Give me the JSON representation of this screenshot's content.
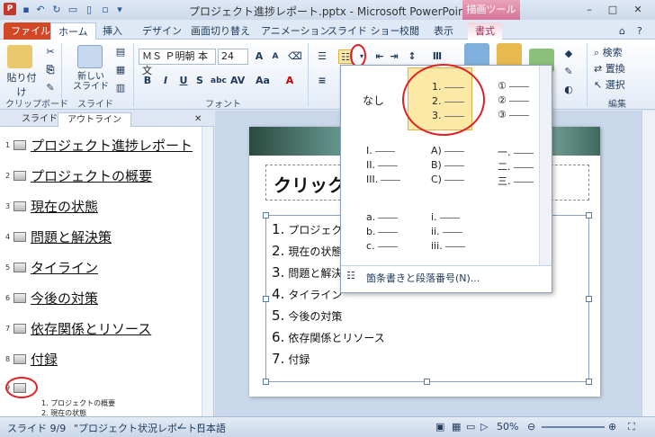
{
  "titlebar": {
    "title": "プロジェクト進捗レポート.pptx - Microsoft PowerPoint",
    "context_tools": "描画ツール",
    "app_icon": "P"
  },
  "tabs": [
    "ファイル",
    "ホーム",
    "挿入",
    "デザイン",
    "画面切り替え",
    "アニメーション",
    "スライド ショー",
    "校閲",
    "表示",
    "書式"
  ],
  "ribbon": {
    "paste_label": "貼り付け",
    "new_slide_label": "新しい\nスライド",
    "clipboard_group": "クリップボード",
    "slides_group": "スライド",
    "font_group": "フォント",
    "edit_group": "編集",
    "font_name": "ＭＳ Ｐ明朝 本文",
    "font_size": "24",
    "search_label": "検索",
    "replace_label": "置換",
    "select_label": "選択"
  },
  "left_panel": {
    "tabs": [
      "スライド",
      "アウトライン"
    ],
    "items": [
      {
        "num": "1",
        "text": "プロジェクト進捗レポート"
      },
      {
        "num": "2",
        "text": "プロジェクトの概要"
      },
      {
        "num": "3",
        "text": "現在の状態"
      },
      {
        "num": "4",
        "text": "問題と解決策"
      },
      {
        "num": "5",
        "text": "タイライン"
      },
      {
        "num": "6",
        "text": "今後の対策"
      },
      {
        "num": "7",
        "text": "依存関係とリソース"
      },
      {
        "num": "8",
        "text": "付録"
      },
      {
        "num": "9",
        "text": ""
      }
    ],
    "sub_items": [
      "1. プロジェクトの概要",
      "2. 現在の状態"
    ]
  },
  "slide": {
    "title": "クリック",
    "bullets": [
      {
        "num": "1.",
        "text": "プロジェク"
      },
      {
        "num": "2.",
        "text": "現在の状態"
      },
      {
        "num": "3.",
        "text": "問題と解決"
      },
      {
        "num": "4.",
        "text": "タイライン"
      },
      {
        "num": "5.",
        "text": "今後の対策"
      },
      {
        "num": "6.",
        "text": "依存関係とリソース"
      },
      {
        "num": "7.",
        "text": "付録"
      }
    ]
  },
  "gallery": {
    "none_label": "なし",
    "styles": [
      [
        "1.",
        "2.",
        "3."
      ],
      [
        "①",
        "②",
        "③"
      ],
      [
        "I.",
        "II.",
        "III."
      ],
      [
        "A)",
        "B)",
        "C)"
      ],
      [
        "一.",
        "二.",
        "三."
      ],
      [
        "a.",
        "b.",
        "c."
      ],
      [
        "i.",
        "ii.",
        "iii."
      ]
    ],
    "footer": "箇条書きと段落番号(N)..."
  },
  "statusbar": {
    "slide": "スライド 9/9",
    "theme": "\"プロジェクト状況レポート\"",
    "lang": "日本語",
    "zoom": "50%"
  },
  "colors": {
    "file_tab": "#d24726",
    "highlight": "#e02020",
    "selection": "#fde9a6"
  }
}
